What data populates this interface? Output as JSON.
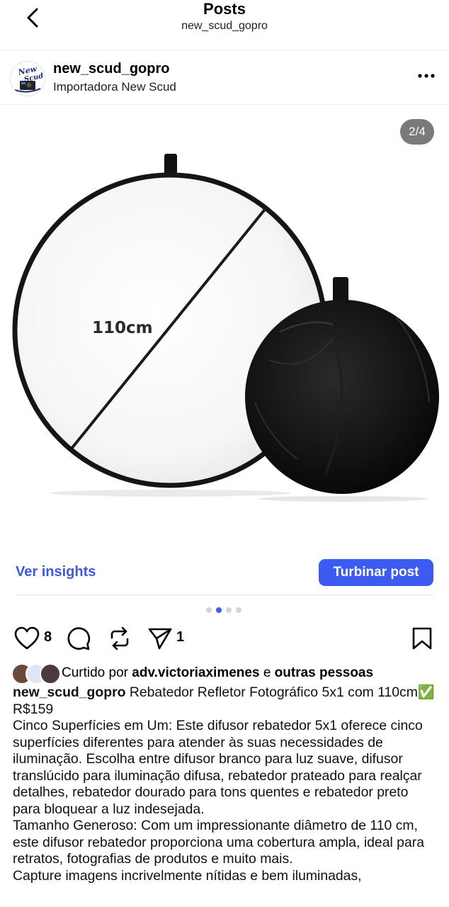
{
  "header": {
    "title": "Posts",
    "subtitle": "new_scud_gopro",
    "back_icon": "chevron-left-icon"
  },
  "profile": {
    "username": "new_scud_gopro",
    "company": "Importadora New Scud",
    "avatar_text": "New Scud",
    "more_icon": "more-horizontal-icon"
  },
  "photo": {
    "counter": "2/4",
    "label": "110cm",
    "current_index": 2,
    "total": 4
  },
  "insights": {
    "link": "Ver insights",
    "button": "Turbinar post",
    "accent": "#3d5af1"
  },
  "actions": {
    "likes": "8",
    "shares": "1",
    "icons": [
      "heart-icon",
      "comment-icon",
      "repost-icon",
      "share-icon",
      "bookmark-icon"
    ]
  },
  "likes_line": {
    "prefix": "Curtido por",
    "user": "adv.victoriaximenes",
    "conj": "e",
    "others": "outras pessoas"
  },
  "caption": {
    "username": "new_scud_gopro",
    "title": "Rebatedor Refletor Fotográfico 5x1 com 110cm✅",
    "price": "R$159",
    "para1": "Cinco Superfícies em Um: Este difusor rebatedor 5x1 oferece cinco superfícies diferentes para atender às suas necessidades de iluminação. Escolha entre difusor branco para luz suave, difusor translúcido para iluminação difusa, rebatedor prateado para realçar detalhes, rebatedor dourado para tons quentes e rebatedor preto para bloquear a luz indesejada.",
    "para2": "Tamanho Generoso: Com um impressionante diâmetro de 110 cm, este difusor rebatedor proporciona uma cobertura ampla, ideal para retratos, fotografias de produtos e muito mais.",
    "para3": "Capture imagens incrivelmente nítidas e bem iluminadas,"
  }
}
